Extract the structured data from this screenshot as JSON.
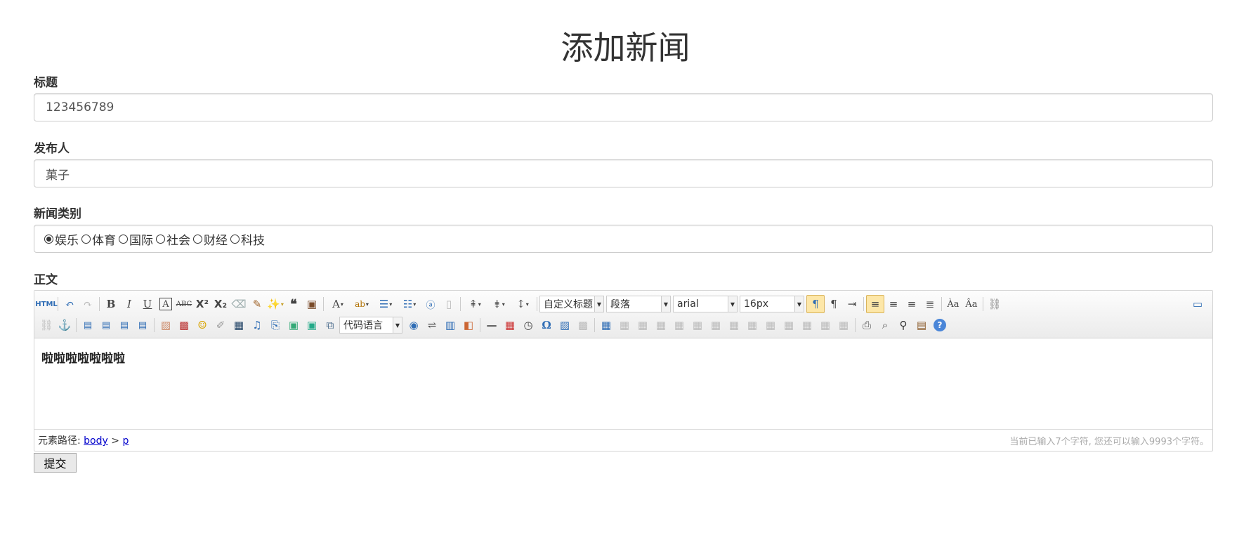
{
  "page": {
    "title": "添加新闻"
  },
  "form": {
    "title_label": "标题",
    "title_value": "123456789",
    "author_label": "发布人",
    "author_value": "菓子",
    "category_label": "新闻类别",
    "categories": [
      {
        "label": "娱乐",
        "checked": true
      },
      {
        "label": "体育",
        "checked": false
      },
      {
        "label": "国际",
        "checked": false
      },
      {
        "label": "社会",
        "checked": false
      },
      {
        "label": "财经",
        "checked": false
      },
      {
        "label": "科技",
        "checked": false
      }
    ],
    "body_label": "正文",
    "submit_label": "提交"
  },
  "editor": {
    "toolbar": {
      "html_label": "HTML",
      "combo_custom_heading": "自定义标题",
      "combo_paragraph": "段落",
      "combo_font": "arial",
      "combo_size": "16px",
      "combo_code_lang": "代码语言"
    },
    "content": "啦啦啦啦啦啦啦",
    "status": {
      "path_label": "元素路径:",
      "path_body": "body",
      "path_sep": ">",
      "path_p": "p",
      "count_text": "当前已输入7个字符, 您还可以输入9993个字符。"
    }
  },
  "colors": {
    "active_button_bg": "#fde7a8",
    "link": "#0000cc"
  }
}
